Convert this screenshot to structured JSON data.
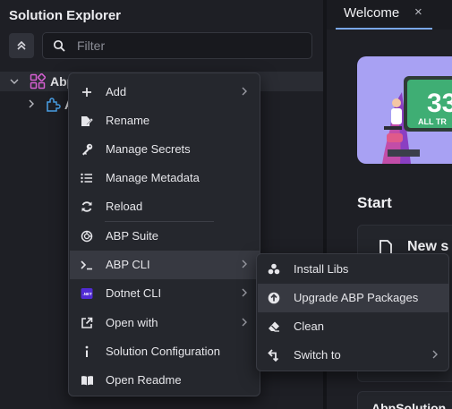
{
  "explorer": {
    "title": "Solution Explorer",
    "filter_placeholder": "Filter",
    "tree": [
      {
        "label": "Abp",
        "icon": "project-grid-icon",
        "expanded": true
      },
      {
        "label": "A",
        "icon": "module-puzzle-icon",
        "expanded": false
      }
    ]
  },
  "editor": {
    "tab_label": "Welcome",
    "tab_close": "×",
    "banner_number": "33",
    "banner_caption": "ALL TR",
    "start_heading": "Start",
    "new_card_label": "New s",
    "bottom_card_label": "AbpSolution"
  },
  "context_menu": {
    "items": [
      {
        "label": "Add",
        "icon": "plus-icon",
        "submenu": true
      },
      {
        "label": "Rename",
        "icon": "rename-icon",
        "submenu": false
      },
      {
        "label": "Manage Secrets",
        "icon": "key-icon",
        "submenu": false
      },
      {
        "label": "Manage Metadata",
        "icon": "list-icon",
        "submenu": false
      },
      {
        "label": "Reload",
        "icon": "reload-icon",
        "submenu": false
      },
      {
        "label": "ABP Suite",
        "icon": "abp-suite-icon",
        "submenu": false
      },
      {
        "label": "ABP CLI",
        "icon": "terminal-icon",
        "submenu": true,
        "highlighted": true
      },
      {
        "label": "Dotnet CLI",
        "icon": "dotnet-icon",
        "submenu": true
      },
      {
        "label": "Open with",
        "icon": "open-external-icon",
        "submenu": true
      },
      {
        "label": "Solution Configuration",
        "icon": "info-icon",
        "submenu": false
      },
      {
        "label": "Open Readme",
        "icon": "book-icon",
        "submenu": false
      }
    ]
  },
  "submenu": {
    "items": [
      {
        "label": "Install Libs",
        "icon": "install-libs-icon",
        "submenu": false
      },
      {
        "label": "Upgrade ABP Packages",
        "icon": "upgrade-icon",
        "submenu": false,
        "highlighted": true
      },
      {
        "label": "Clean",
        "icon": "eraser-icon",
        "submenu": false
      },
      {
        "label": "Switch to",
        "icon": "switch-icon",
        "submenu": true
      }
    ]
  },
  "colors": {
    "accent": "#7aa7e8",
    "panel": "#1e1f25",
    "menu_bg": "#25272d",
    "highlight": "#373941",
    "project_icon": "#d55fd1",
    "module_icon": "#4aa0e6",
    "banner": "#a8a1f3"
  }
}
